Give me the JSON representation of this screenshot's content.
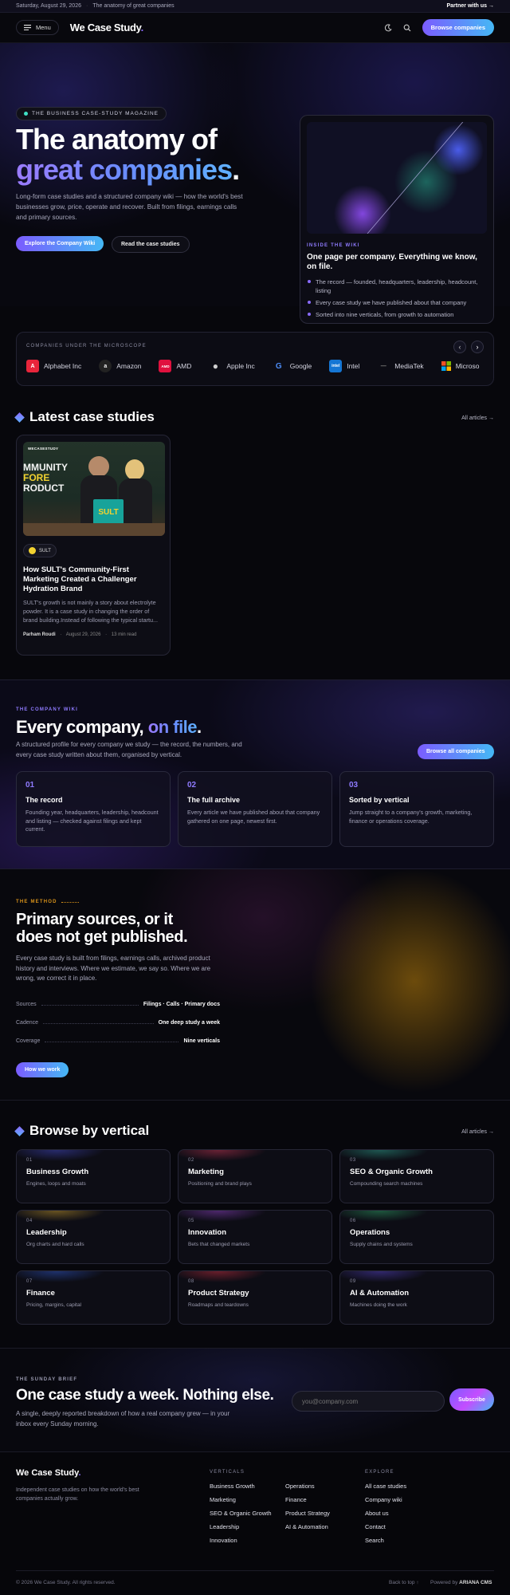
{
  "topbar": {
    "date": "Saturday, August 29, 2026",
    "sep": "·",
    "tagline": "The anatomy of great companies",
    "partner": "Partner with us →"
  },
  "header": {
    "menu_label": "Menu",
    "logo": "We Case Study",
    "logo_dot": ".",
    "cta": "Browse companies"
  },
  "hero": {
    "badge": "THE BUSINESS CASE-STUDY MAGAZINE",
    "title_line1": "The anatomy of",
    "title_line2": "great companies",
    "title_dot": ".",
    "paragraph": "Long-form case studies and a structured company wiki — how the world's best businesses grow, price, operate and recover. Built from filings, earnings calls and primary sources.",
    "primary_btn": "Explore the Company Wiki",
    "secondary_btn": "Read the case studies",
    "card": {
      "kicker": "INSIDE THE WIKI",
      "title": "One page per company. Everything we know, on file.",
      "items": [
        "The record — founded, headquarters, leadership, headcount, listing",
        "Every case study we have published about that company",
        "Sorted into nine verticals, from growth to automation"
      ]
    }
  },
  "logos": {
    "label": "COMPANIES UNDER THE MICROSCOPE",
    "prev": "‹",
    "next": "›",
    "items": [
      {
        "name": "Alphabet Inc",
        "glyph": "A",
        "color": "#e8253b"
      },
      {
        "name": "Amazon",
        "glyph": "a",
        "color": "#f2f2f2"
      },
      {
        "name": "AMD",
        "glyph": "AMD",
        "color": "#e0113e"
      },
      {
        "name": "Apple Inc",
        "glyph": "●",
        "color": "#cfcfcf"
      },
      {
        "name": "Google",
        "glyph": "G",
        "color": "#ffffff"
      },
      {
        "name": "Intel",
        "glyph": "intel",
        "color": "#1576d4"
      },
      {
        "name": "MediaTek",
        "glyph": "—",
        "color": "#8a8a8a"
      },
      {
        "name": "Microso",
        "glyph": "■",
        "color": "#f25022"
      }
    ]
  },
  "latest": {
    "title": "Latest case studies",
    "all_link": "All articles →",
    "card": {
      "image_brand": "WECASESTUDY",
      "image_text": [
        "MMUNITY",
        "FORE",
        "RODUCT"
      ],
      "product": "SULT",
      "tag": "SULT",
      "title": "How SULT's Community-First Marketing Created a Challenger Hydration Brand",
      "excerpt": "SULT's growth is not mainly a story about electrolyte powder. It is a case study in changing the order of brand building.Instead of following the typical startu...",
      "author": "Parham Roudi",
      "date": "August 29, 2026",
      "read": "13 min read",
      "dot": "·"
    }
  },
  "wiki": {
    "kicker": "THE COMPANY WIKI",
    "title_a": "Every company,",
    "title_b": "on file",
    "title_dot": ".",
    "paragraph": "A structured profile for every company we study — the record, the numbers, and every case study written about them, organised by vertical.",
    "button": "Browse all companies",
    "features": [
      {
        "num": "01",
        "title": "The record",
        "desc": "Founding year, headquarters, leadership, headcount and listing — checked against filings and kept current."
      },
      {
        "num": "02",
        "title": "The full archive",
        "desc": "Every article we have published about that company gathered on one page, newest first."
      },
      {
        "num": "03",
        "title": "Sorted by vertical",
        "desc": "Jump straight to a company's growth, marketing, finance or operations coverage."
      }
    ]
  },
  "method": {
    "kicker": "THE METHOD",
    "title_l1": "Primary sources, or it",
    "title_l2": "does not get published.",
    "paragraph": "Every case study is built from filings, earnings calls, archived product history and interviews. Where we estimate, we say so. Where we are wrong, we correct it in place.",
    "rows": [
      {
        "label": "Sources",
        "value": "Filings · Calls · Primary docs"
      },
      {
        "label": "Cadence",
        "value": "One deep study a week"
      },
      {
        "label": "Coverage",
        "value": "Nine verticals"
      }
    ],
    "button": "How we work"
  },
  "verticals": {
    "title": "Browse by vertical",
    "all_link": "All articles →",
    "items": [
      {
        "num": "01",
        "name": "Business Growth",
        "desc": "Engines, loops and moats",
        "glow": "#3a3fa8"
      },
      {
        "num": "02",
        "name": "Marketing",
        "desc": "Positioning and brand plays",
        "glow": "#a8304a"
      },
      {
        "num": "03",
        "name": "SEO & Organic Growth",
        "desc": "Compounding search machines",
        "glow": "#2a8a7a"
      },
      {
        "num": "04",
        "name": "Leadership",
        "desc": "Org charts and hard calls",
        "glow": "#a8842a"
      },
      {
        "num": "05",
        "name": "Innovation",
        "desc": "Bets that changed markets",
        "glow": "#7a3aa8"
      },
      {
        "num": "06",
        "name": "Operations",
        "desc": "Supply chains and systems",
        "glow": "#2a8a5a"
      },
      {
        "num": "07",
        "name": "Finance",
        "desc": "Pricing, margins, capital",
        "glow": "#2a4aa8"
      },
      {
        "num": "08",
        "name": "Product Strategy",
        "desc": "Roadmaps and teardowns",
        "glow": "#a82a3a"
      },
      {
        "num": "09",
        "name": "AI & Automation",
        "desc": "Machines doing the work",
        "glow": "#4a3aa8"
      }
    ]
  },
  "newsletter": {
    "kicker": "THE SUNDAY BRIEF",
    "title": "One case study a week. Nothing else.",
    "paragraph": "A single, deeply reported breakdown of how a real company grew — in your inbox every Sunday morning.",
    "placeholder": "you@company.com",
    "button": "Subscribe"
  },
  "footer": {
    "logo": "We Case Study",
    "logo_dot": ".",
    "about": "Independent case studies on how the world's best companies actually grow.",
    "verticals_heading": "VERTICALS",
    "col1": [
      "Business Growth",
      "Marketing",
      "SEO & Organic Growth",
      "Leadership",
      "Innovation"
    ],
    "col2": [
      "Operations",
      "Finance",
      "Product Strategy",
      "AI & Automation"
    ],
    "explore_heading": "EXPLORE",
    "explore": [
      "All case studies",
      "Company wiki",
      "About us",
      "Contact",
      "Search"
    ],
    "copyright": "© 2026 We Case Study. All rights reserved.",
    "back_to_top": "Back to top ↑",
    "powered_prefix": "Powered by",
    "powered_brand": "ARIANA CMS"
  },
  "colors": {
    "accent": "#8a6bff",
    "accent2": "#45b8f5",
    "gold": "#c9860f",
    "bg": "#07070c"
  }
}
